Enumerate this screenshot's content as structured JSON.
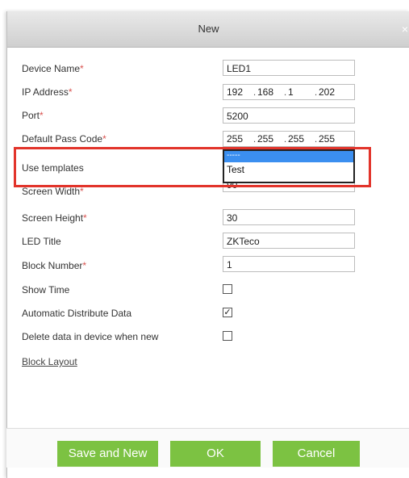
{
  "dialog": {
    "title": "New",
    "close_icon": "×"
  },
  "fields": {
    "device_name": {
      "label": "Device Name",
      "required": "*",
      "value": "LED1"
    },
    "ip_address": {
      "label": "IP Address",
      "required": "*",
      "seg1": "192",
      "seg2": "168",
      "seg3": "1",
      "seg4": "202"
    },
    "port": {
      "label": "Port",
      "required": "*",
      "value": "5200"
    },
    "default_pass_code": {
      "label": "Default Pass Code",
      "required": "*",
      "seg1": "255",
      "seg2": "255",
      "seg3": "255",
      "seg4": "255"
    },
    "use_templates": {
      "label": "Use templates",
      "options": [
        "-----",
        "Test"
      ],
      "selected": "-----"
    },
    "screen_width": {
      "label": "Screen Width",
      "required": "*",
      "value": "90"
    },
    "screen_height": {
      "label": "Screen Height",
      "required": "*",
      "value": "30"
    },
    "led_title": {
      "label": "LED Title",
      "value": "ZKTeco"
    },
    "block_number": {
      "label": "Block Number",
      "required": "*",
      "value": "1"
    },
    "show_time": {
      "label": "Show Time",
      "checked": ""
    },
    "automatic_distribute": {
      "label": "Automatic Distribute Data",
      "checked": "✓"
    },
    "delete_data": {
      "label": "Delete data in device when new",
      "checked": ""
    }
  },
  "links": {
    "block_layout": "Block Layout"
  },
  "buttons": {
    "save_and_new": "Save and New",
    "ok": "OK",
    "cancel": "Cancel"
  },
  "colors": {
    "required": "#d9534f",
    "button": "#7cc242",
    "highlight": "#e2342b",
    "dropdown_selected": "#3b8ff0"
  }
}
